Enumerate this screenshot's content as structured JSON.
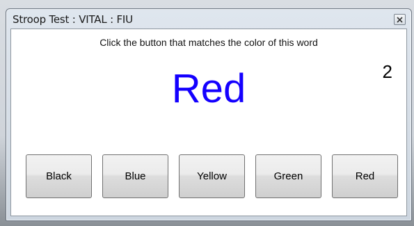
{
  "window": {
    "title": "Stroop Test : VITAL : FIU",
    "close_icon": "close-icon"
  },
  "task": {
    "instruction": "Click the button that matches the color of this word",
    "counter": "2",
    "stimulus_word": "Red",
    "stimulus_color": "#1400ff"
  },
  "buttons": [
    {
      "label": "Black"
    },
    {
      "label": "Blue"
    },
    {
      "label": "Yellow"
    },
    {
      "label": "Green"
    },
    {
      "label": "Red"
    }
  ]
}
